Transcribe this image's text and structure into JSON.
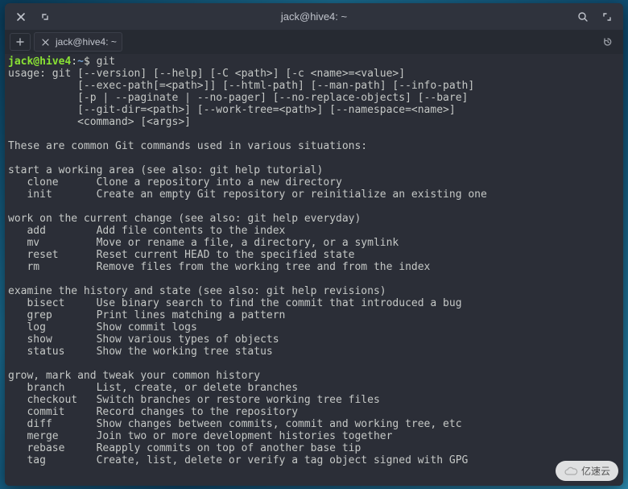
{
  "window": {
    "title": "jack@hive4: ~"
  },
  "tab": {
    "label": "jack@hive4: ~"
  },
  "prompt": {
    "user_host": "jack@hive4",
    "separator": ":",
    "path": "~",
    "symbol": "$",
    "command": "git"
  },
  "output": "usage: git [--version] [--help] [-C <path>] [-c <name>=<value>]\n           [--exec-path[=<path>]] [--html-path] [--man-path] [--info-path]\n           [-p | --paginate | --no-pager] [--no-replace-objects] [--bare]\n           [--git-dir=<path>] [--work-tree=<path>] [--namespace=<name>]\n           <command> [<args>]\n\nThese are common Git commands used in various situations:\n\nstart a working area (see also: git help tutorial)\n   clone      Clone a repository into a new directory\n   init       Create an empty Git repository or reinitialize an existing one\n\nwork on the current change (see also: git help everyday)\n   add        Add file contents to the index\n   mv         Move or rename a file, a directory, or a symlink\n   reset      Reset current HEAD to the specified state\n   rm         Remove files from the working tree and from the index\n\nexamine the history and state (see also: git help revisions)\n   bisect     Use binary search to find the commit that introduced a bug\n   grep       Print lines matching a pattern\n   log        Show commit logs\n   show       Show various types of objects\n   status     Show the working tree status\n\ngrow, mark and tweak your common history\n   branch     List, create, or delete branches\n   checkout   Switch branches or restore working tree files\n   commit     Record changes to the repository\n   diff       Show changes between commits, commit and working tree, etc\n   merge      Join two or more development histories together\n   rebase     Reapply commits on top of another base tip\n   tag        Create, list, delete or verify a tag object signed with GPG",
  "watermark": "亿速云"
}
